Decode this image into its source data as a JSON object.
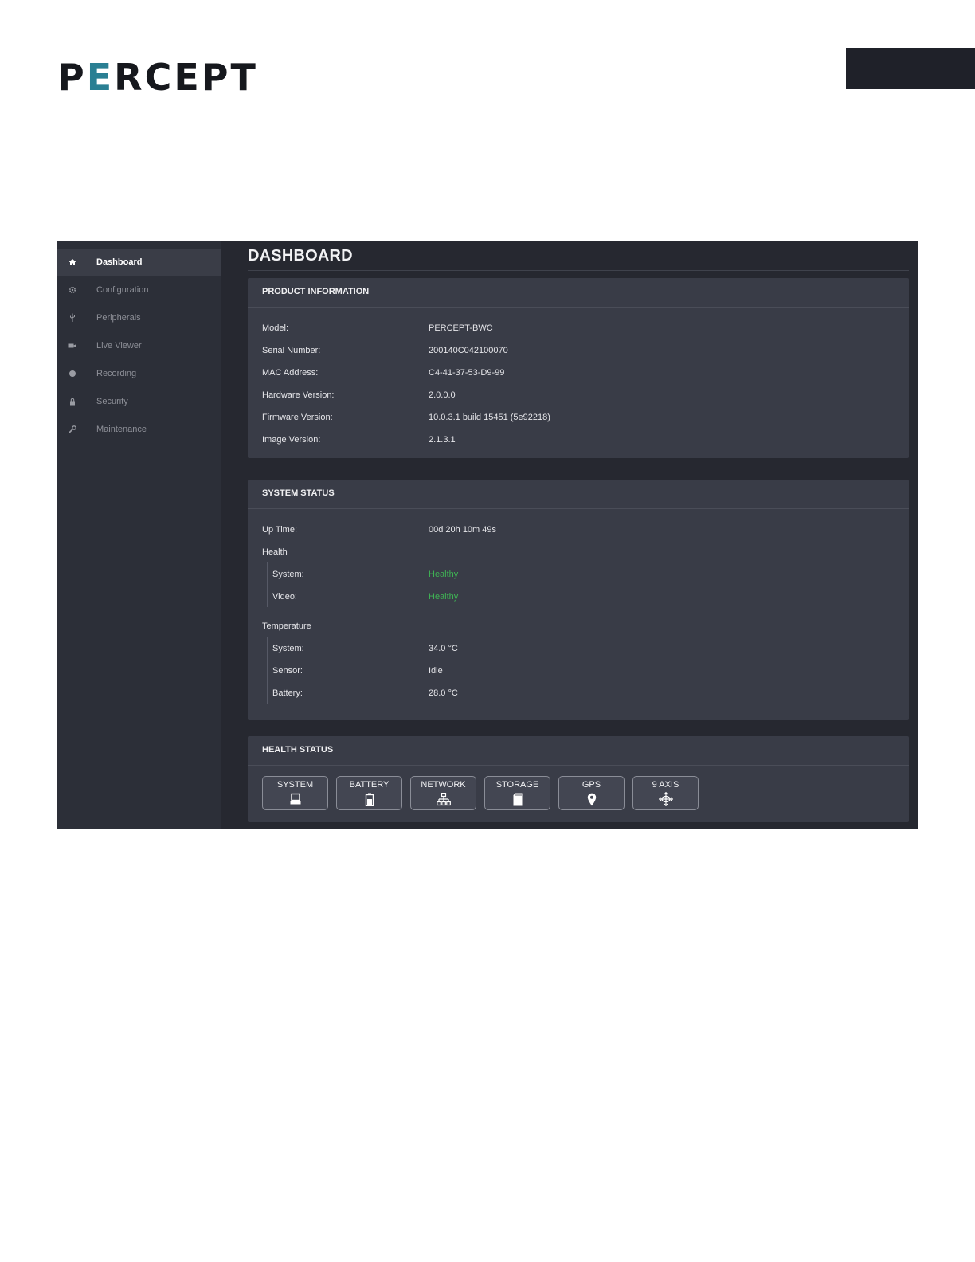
{
  "brand": {
    "logo_part1": "P",
    "logo_accent": "E",
    "logo_part2": "RCEPT"
  },
  "sidebar": {
    "items": [
      {
        "label": "Dashboard",
        "icon": "home-icon",
        "active": true
      },
      {
        "label": "Configuration",
        "icon": "gear-icon"
      },
      {
        "label": "Peripherals",
        "icon": "usb-icon"
      },
      {
        "label": "Live Viewer",
        "icon": "camera-icon"
      },
      {
        "label": "Recording",
        "icon": "record-dot-icon"
      },
      {
        "label": "Security",
        "icon": "lock-icon"
      },
      {
        "label": "Maintenance",
        "icon": "wrench-icon"
      }
    ]
  },
  "page": {
    "title": "DASHBOARD"
  },
  "product_info": {
    "title": "PRODUCT INFORMATION",
    "rows": [
      {
        "key": "Model:",
        "value": "PERCEPT-BWC"
      },
      {
        "key": "Serial Number:",
        "value": "200140C042100070"
      },
      {
        "key": "MAC Address:",
        "value": "C4-41-37-53-D9-99"
      },
      {
        "key": "Hardware Version:",
        "value": "2.0.0.0"
      },
      {
        "key": "Firmware Version:",
        "value": "10.0.3.1 build 15451 (5e92218)"
      },
      {
        "key": "Image Version:",
        "value": "2.1.3.1"
      }
    ]
  },
  "system_status": {
    "title": "SYSTEM STATUS",
    "uptime": {
      "key": "Up Time:",
      "value": "00d 20h 10m 49s"
    },
    "health": {
      "heading": "Health",
      "system": {
        "key": "System:",
        "value": "Healthy"
      },
      "video": {
        "key": "Video:",
        "value": "Healthy"
      }
    },
    "temperature": {
      "heading": "Temperature",
      "system": {
        "key": "System:",
        "value": "34.0 °C"
      },
      "sensor": {
        "key": "Sensor:",
        "value": "Idle"
      },
      "battery": {
        "key": "Battery:",
        "value": "28.0 °C"
      }
    }
  },
  "health_status": {
    "title": "HEALTH STATUS",
    "buttons": [
      {
        "label": "SYSTEM",
        "icon": "computer-icon"
      },
      {
        "label": "BATTERY",
        "icon": "battery-icon"
      },
      {
        "label": "NETWORK",
        "icon": "network-icon"
      },
      {
        "label": "STORAGE",
        "icon": "sd-card-icon"
      },
      {
        "label": "GPS",
        "icon": "map-pin-icon"
      },
      {
        "label": "9 AXIS",
        "icon": "axis-icon"
      }
    ]
  },
  "colors": {
    "good": "#3fb454",
    "accent": "#2a7f93",
    "panel": "#393c47"
  }
}
